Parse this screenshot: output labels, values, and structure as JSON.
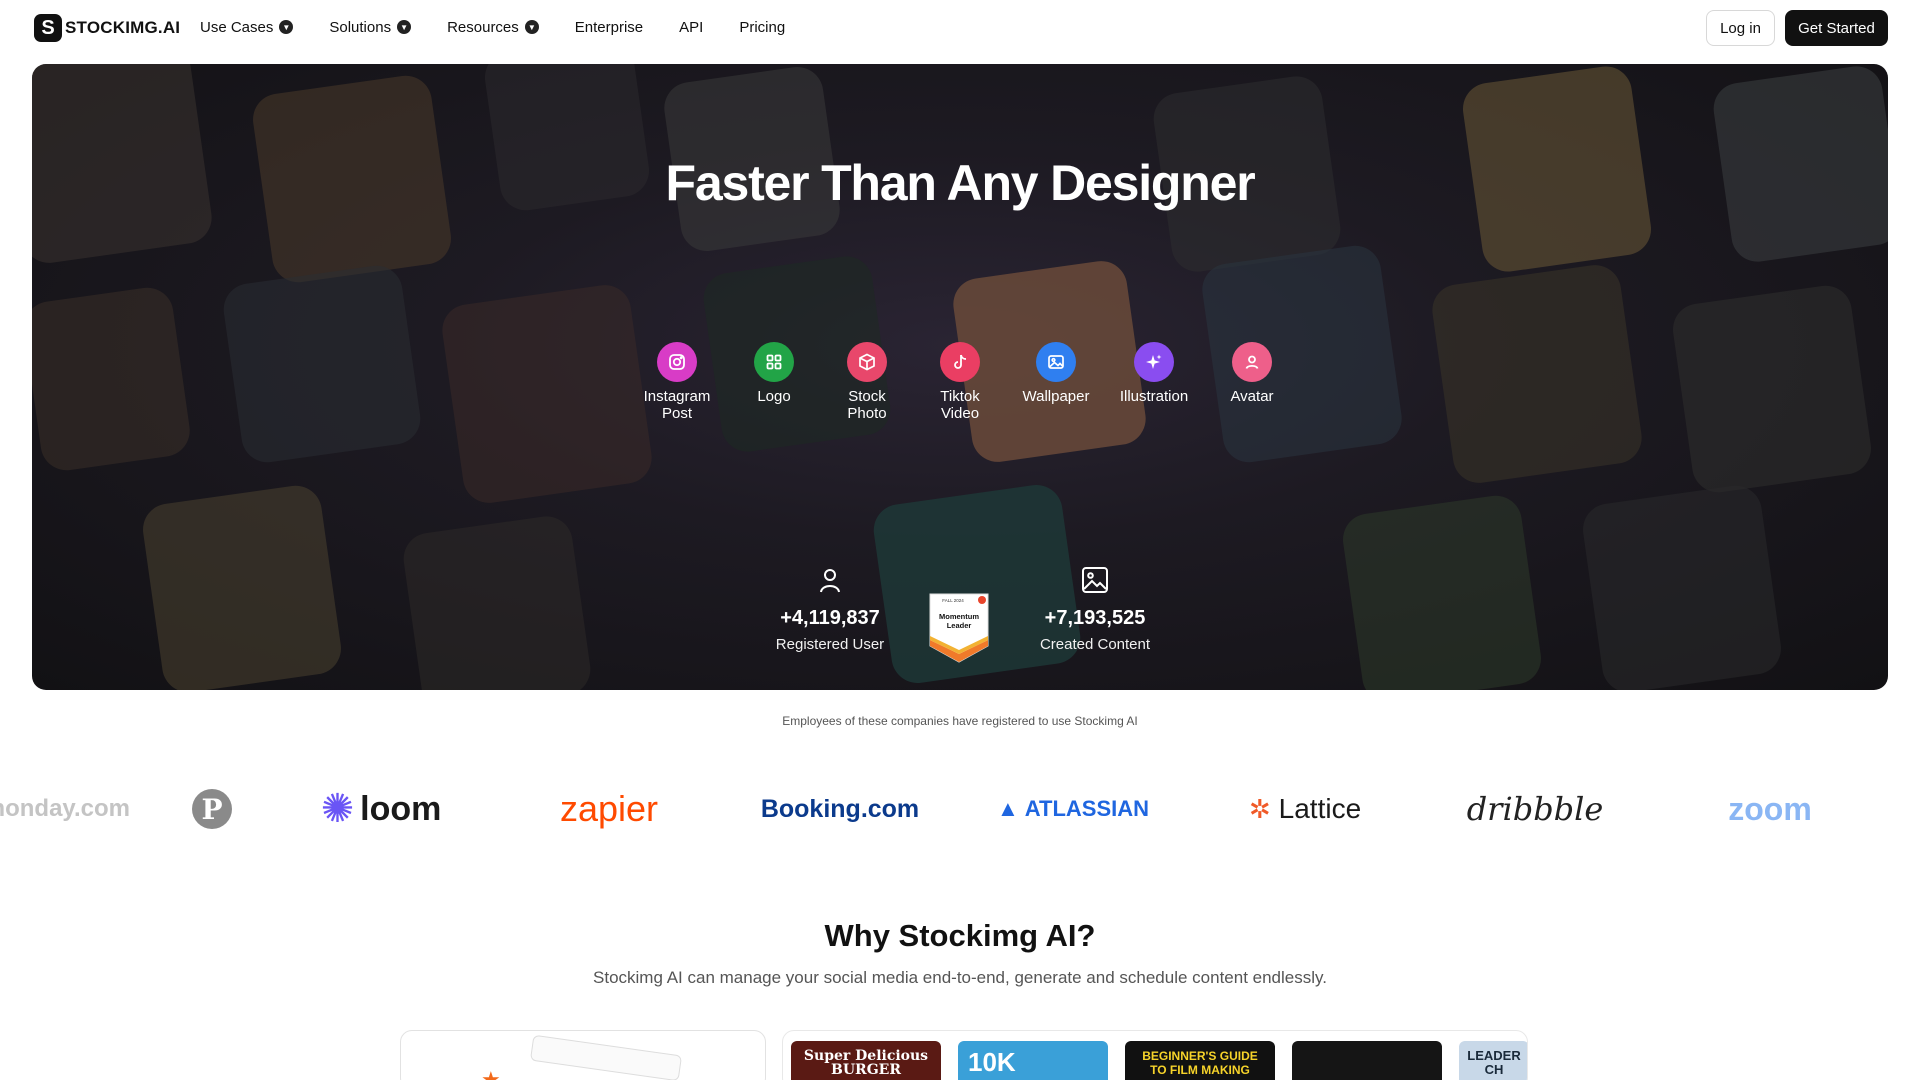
{
  "brand": {
    "name": "STOCKIMG.AI",
    "mark": "S"
  },
  "nav": {
    "items": [
      {
        "label": "Use Cases",
        "dropdown": true
      },
      {
        "label": "Solutions",
        "dropdown": true
      },
      {
        "label": "Resources",
        "dropdown": true
      },
      {
        "label": "Enterprise",
        "dropdown": false
      },
      {
        "label": "API",
        "dropdown": false
      },
      {
        "label": "Pricing",
        "dropdown": false
      }
    ],
    "login_label": "Log in",
    "cta_label": "Get Started"
  },
  "hero": {
    "title": "Faster Than Any Designer",
    "features": [
      {
        "label": "Instagram Post",
        "icon": "instagram-icon",
        "color": "#d83cc6"
      },
      {
        "label": "Logo",
        "icon": "grid-icon",
        "color": "#22a447"
      },
      {
        "label": "Stock Photo",
        "icon": "box-icon",
        "color": "#e8476b"
      },
      {
        "label": "Tiktok Video",
        "icon": "tiktok-icon",
        "color": "#ea3e63"
      },
      {
        "label": "Wallpaper",
        "icon": "image-icon",
        "color": "#2f7ff0"
      },
      {
        "label": "Illustration",
        "icon": "sparkle-icon",
        "color": "#8a4df0"
      },
      {
        "label": "Avatar",
        "icon": "user-icon",
        "color": "#ee5f8a"
      }
    ],
    "stats": {
      "users": {
        "value": "+4,119,837",
        "label": "Registered User",
        "icon": "user-icon"
      },
      "content": {
        "value": "+7,193,525",
        "label": "Created Content",
        "icon": "image-icon"
      }
    },
    "badge": {
      "season": "FALL 2024",
      "title_line1": "Momentum",
      "title_line2": "Leader"
    }
  },
  "companies": {
    "caption": "Employees of these companies have registered to use Stockimg AI",
    "logos": [
      "monday.com",
      "Pinterest",
      "loom",
      "zapier",
      "Booking.com",
      "ATLASSIAN",
      "Lattice",
      "dribbble",
      "zoom"
    ]
  },
  "why": {
    "title": "Why Stockimg AI?",
    "subtitle": "Stockimg AI can manage your social media end-to-end, generate and schedule content endlessly."
  },
  "thumbnails": [
    {
      "text": "Super Delicious BURGER",
      "color": "#5a1a14"
    },
    {
      "text": "10K",
      "color": "#3aa0d8"
    },
    {
      "text": "BEGINNER'S GUIDE TO FILM MAKING",
      "color": "#111111"
    },
    {
      "text": "",
      "color": "#151515"
    },
    {
      "text": "LEADER CH",
      "color": "#c8d8e8"
    }
  ],
  "colors": {
    "dark": "#111111",
    "hero_bg": "#1b191e",
    "muted": "#555555"
  }
}
